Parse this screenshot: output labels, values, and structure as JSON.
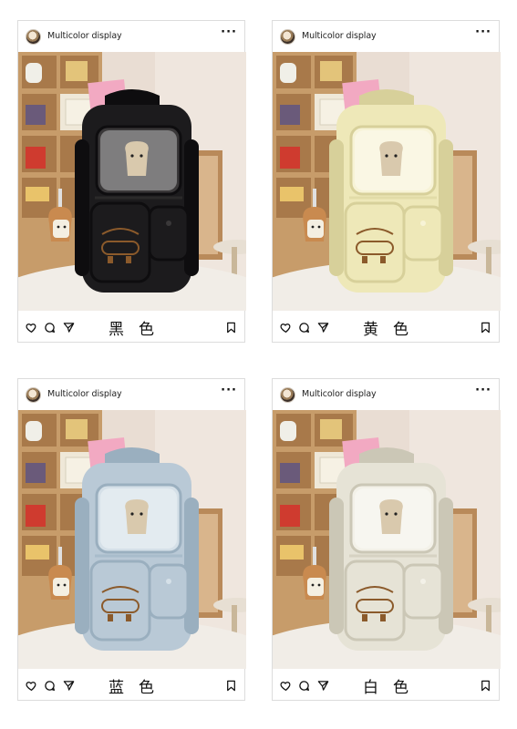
{
  "posts": [
    {
      "username": "Multicolor display",
      "caption_a": "黑",
      "caption_b": "色",
      "bag_color": "#1c1b1d",
      "bag_shade": "#0e0d0f",
      "bag_light": "#3a3839",
      "trim": "#2a2929"
    },
    {
      "username": "Multicolor display",
      "caption_a": "黄",
      "caption_b": "色",
      "bag_color": "#eee8b8",
      "bag_shade": "#d7d09a",
      "bag_light": "#f7f3d6",
      "trim": "#e2dca8"
    },
    {
      "username": "Multicolor display",
      "caption_a": "蓝",
      "caption_b": "色",
      "bag_color": "#b9c9d6",
      "bag_shade": "#9aafbf",
      "bag_light": "#d5e0e8",
      "trim": "#a8bccb"
    },
    {
      "username": "Multicolor display",
      "caption_a": "白",
      "caption_b": "色",
      "bag_color": "#e6e3d6",
      "bag_shade": "#cbc7b6",
      "bag_light": "#f3f1e8",
      "trim": "#d6d2c2"
    }
  ],
  "icons": {
    "more": "more-horizontal-icon",
    "like": "heart-icon",
    "comment": "comment-icon",
    "share": "send-icon",
    "save": "bookmark-icon"
  },
  "more_glyph": "···"
}
